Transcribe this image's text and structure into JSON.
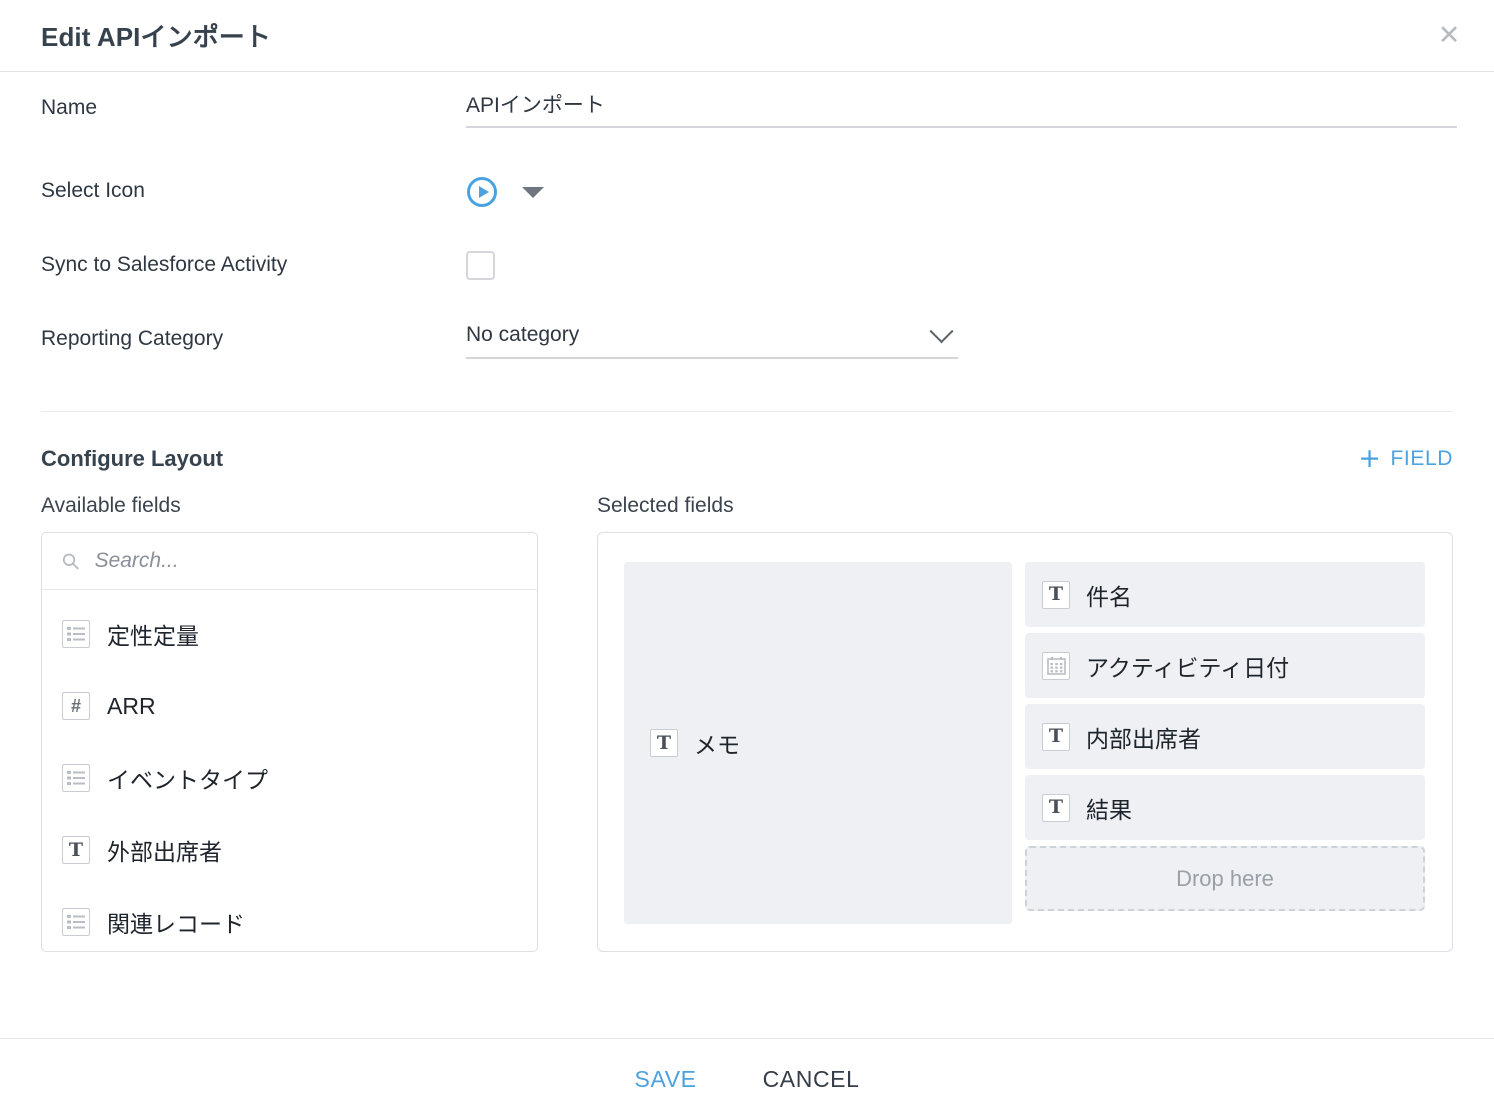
{
  "header": {
    "title": "Edit APIインポート",
    "close_label": "✕"
  },
  "form": {
    "name": {
      "label": "Name",
      "value": "APIインポート",
      "placeholder": ""
    },
    "select_icon": {
      "label": "Select Icon",
      "icon": "play-circle-icon"
    },
    "sync": {
      "label": "Sync to Salesforce Activity",
      "checked": false
    },
    "reporting_category": {
      "label": "Reporting Category",
      "value": "No category"
    }
  },
  "configure_layout": {
    "title": "Configure Layout",
    "add_field_label": "FIELD",
    "add_field_plus": "+",
    "available_caption": "Available fields",
    "selected_caption": "Selected fields",
    "search_placeholder": "Search...",
    "available_fields": [
      {
        "label": "定性定量",
        "type": "list"
      },
      {
        "label": "ARR",
        "type": "number"
      },
      {
        "label": "イベントタイプ",
        "type": "list"
      },
      {
        "label": "外部出席者",
        "type": "text"
      },
      {
        "label": "関連レコード",
        "type": "list"
      }
    ],
    "selected_primary": {
      "label": "メモ",
      "type": "text"
    },
    "selected_fields": [
      {
        "label": "件名",
        "type": "text"
      },
      {
        "label": "アクティビティ日付",
        "type": "date"
      },
      {
        "label": "内部出席者",
        "type": "text"
      },
      {
        "label": "結果",
        "type": "text"
      }
    ],
    "drop_here_label": "Drop here"
  },
  "footer": {
    "save_label": "SAVE",
    "cancel_label": "CANCEL"
  },
  "colors": {
    "accent": "#4aa3e0",
    "text": "#2f3842",
    "chip_bg": "#eef0f4",
    "border": "#dcdfe3"
  }
}
